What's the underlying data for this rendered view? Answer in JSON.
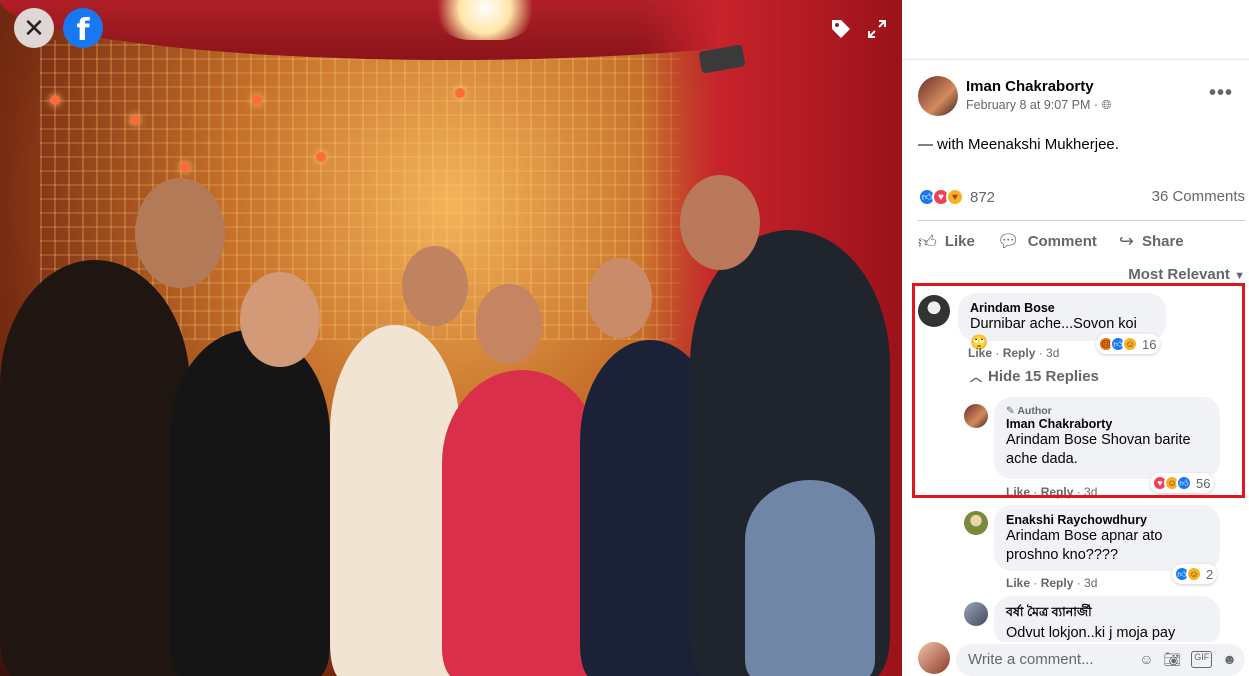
{
  "photo": {
    "close_icon": "close-icon",
    "logo_letter": "f",
    "tag_icon": "tag-icon",
    "expand_icon": "expand-icon"
  },
  "post": {
    "author": "Iman Chakraborty",
    "date": "February 8 at 9:07 PM · ",
    "privacy_icon": "globe-icon",
    "with_prefix": "— with ",
    "with_name": "Meenakshi Mukherjee",
    "with_suffix": ".",
    "reaction_count": "872",
    "comments_count": "36 Comments",
    "actions": {
      "like": "Like",
      "comment": "Comment",
      "share": "Share"
    },
    "sort_label": "Most Relevant"
  },
  "comments": [
    {
      "name": "Arindam Bose",
      "text": "Durnibar ache...Sovon koi",
      "emoji": "🙄",
      "like": "Like",
      "reply": "Reply",
      "time": "3d",
      "reaction_count": "16"
    }
  ],
  "hide_replies": "Hide 15 Replies",
  "replies": [
    {
      "author_tag": "Author",
      "name": "Iman Chakraborty",
      "mention": "Arindam Bose",
      "text": " Shovan barite ache dada.",
      "like": "Like",
      "reply": "Reply",
      "time": "3d",
      "reaction_count": "56"
    },
    {
      "name": "Enakshi Raychowdhury",
      "mention": "Arindam Bose",
      "text": " apnar ato proshno kno????",
      "like": "Like",
      "reply": "Reply",
      "time": "3d",
      "reaction_count": "2"
    },
    {
      "name": "বর্ষা মৈত্র ব্যানার্জী",
      "text": "Odvut lokjon..ki j moja pay"
    }
  ],
  "write_comment": {
    "placeholder": "Write a comment..."
  },
  "colors": {
    "highlight_border": "#e0161e",
    "facebook_blue": "#1877f2"
  }
}
